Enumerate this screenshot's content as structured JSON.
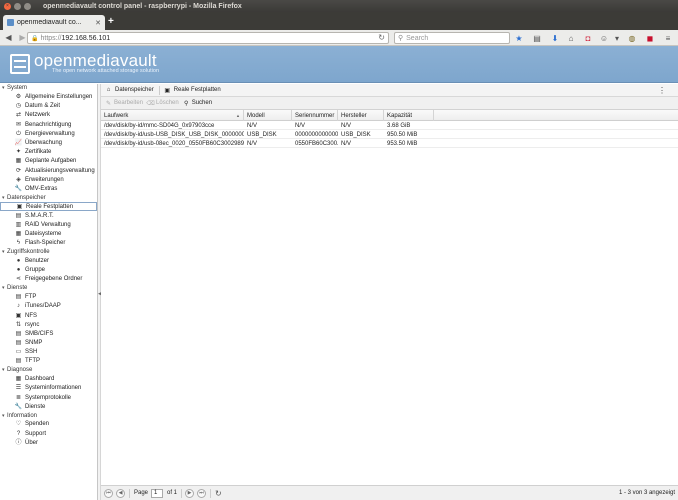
{
  "browser": {
    "window_title": "openmediavault control panel - raspberrypi - Mozilla Firefox",
    "tab_title": "openmediavault co...",
    "new_tab": "+",
    "url_protocol": "https://",
    "url_host": "192.168.56.101",
    "search_placeholder": "Search"
  },
  "header": {
    "brand": "openmediavault",
    "tagline": "The open network attached storage solution"
  },
  "sidebar": {
    "groups": [
      {
        "label": "System",
        "items": [
          {
            "label": "Allgemeine Einstellungen",
            "icon": "gear-icon"
          },
          {
            "label": "Datum & Zeit",
            "icon": "clock-icon"
          },
          {
            "label": "Netzwerk",
            "icon": "network-icon"
          },
          {
            "label": "Benachrichtigung",
            "icon": "mail-icon"
          },
          {
            "label": "Energieverwaltung",
            "icon": "power-icon"
          },
          {
            "label": "Überwachung",
            "icon": "chart-icon"
          },
          {
            "label": "Zertifikate",
            "icon": "certificate-icon"
          },
          {
            "label": "Geplante Aufgaben",
            "icon": "calendar-icon"
          },
          {
            "label": "Aktualisierungsverwaltung",
            "icon": "update-icon"
          },
          {
            "label": "Erweiterungen",
            "icon": "plugin-icon"
          },
          {
            "label": "OMV-Extras",
            "icon": "wrench-icon"
          }
        ]
      },
      {
        "label": "Datenspeicher",
        "items": [
          {
            "label": "Reale Festplatten",
            "icon": "disk-icon",
            "selected": true
          },
          {
            "label": "S.M.A.R.T.",
            "icon": "smart-icon"
          },
          {
            "label": "RAID Verwaltung",
            "icon": "raid-icon"
          },
          {
            "label": "Dateisysteme",
            "icon": "filesystem-icon"
          },
          {
            "label": "Flash-Speicher",
            "icon": "flash-icon"
          }
        ]
      },
      {
        "label": "Zugriffskontrolle",
        "items": [
          {
            "label": "Benutzer",
            "icon": "user-icon"
          },
          {
            "label": "Gruppe",
            "icon": "group-icon"
          },
          {
            "label": "Freigegebene Ordner",
            "icon": "share-icon"
          }
        ]
      },
      {
        "label": "Dienste",
        "items": [
          {
            "label": "FTP",
            "icon": "ftp-icon"
          },
          {
            "label": "iTunes/DAAP",
            "icon": "music-icon"
          },
          {
            "label": "NFS",
            "icon": "nfs-icon"
          },
          {
            "label": "rsync",
            "icon": "sync-icon"
          },
          {
            "label": "SMB/CIFS",
            "icon": "smb-icon"
          },
          {
            "label": "SNMP",
            "icon": "snmp-icon"
          },
          {
            "label": "SSH",
            "icon": "terminal-icon"
          },
          {
            "label": "TFTP",
            "icon": "tftp-icon"
          }
        ]
      },
      {
        "label": "Diagnose",
        "items": [
          {
            "label": "Dashboard",
            "icon": "dashboard-icon"
          },
          {
            "label": "Systeminformationen",
            "icon": "info-list-icon"
          },
          {
            "label": "Systemprotokolle",
            "icon": "log-icon"
          },
          {
            "label": "Dienste",
            "icon": "services-icon"
          }
        ]
      },
      {
        "label": "Information",
        "items": [
          {
            "label": "Spenden",
            "icon": "heart-icon"
          },
          {
            "label": "Support",
            "icon": "question-icon"
          },
          {
            "label": "Über",
            "icon": "info-icon"
          }
        ]
      }
    ]
  },
  "breadcrumb": {
    "section": "Datenspeicher",
    "page": "Reale Festplatten"
  },
  "toolbar": {
    "wipe_label": "Bearbeiten",
    "erase_label": "Löschen",
    "search_label": "Suchen"
  },
  "grid": {
    "columns": [
      "Laufwerk",
      "Modell",
      "Seriennummer",
      "Hersteller",
      "Kapazität"
    ],
    "rows": [
      [
        "/dev/disk/by-id/mmc-SD04G_0x97903cce",
        "N/V",
        "N/V",
        "N/V",
        "3.68 GiB"
      ],
      [
        "/dev/disk/by-id/usb-USB_DISK_USB_DISK_000000000000...",
        "USB_DISK",
        "00000000000000...",
        "USB_DISK",
        "950.50 MiB"
      ],
      [
        "/dev/disk/by-id/usb-08ec_0020_0550FB60C3002989-0:0",
        "N/V",
        "0550FB60C300...",
        "N/V",
        "953.50 MiB"
      ]
    ]
  },
  "pager": {
    "page_label": "Page",
    "page_value": "1",
    "of_label": "of 1",
    "info": "1 - 3 von 3 angezeigt"
  }
}
